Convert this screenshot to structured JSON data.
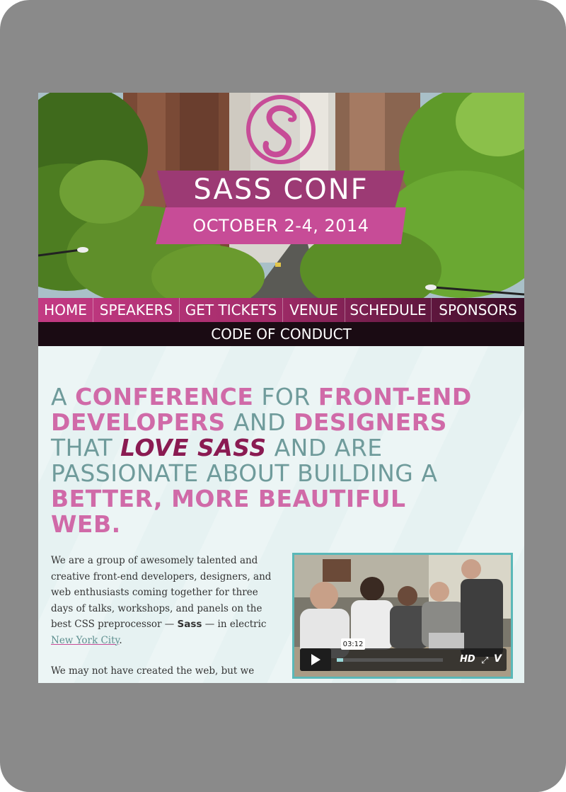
{
  "site": {
    "title": "SASS CONF",
    "dates": "OCTOBER 2-4, 2014"
  },
  "nav": {
    "items": [
      {
        "label": "HOME"
      },
      {
        "label": "SPEAKERS"
      },
      {
        "label": "GET TICKETS"
      },
      {
        "label": "VENUE"
      },
      {
        "label": "SCHEDULE"
      },
      {
        "label": "SPONSORS"
      }
    ],
    "code_of_conduct": "CODE OF CONDUCT"
  },
  "tagline": {
    "p1": "A ",
    "h1": "CONFERENCE",
    "p2": " FOR ",
    "h2": "FRONT-END DEVELOPERS",
    "p3": " AND ",
    "h3": "DESIGNERS",
    "p4": " THAT ",
    "h4": "LOVE SASS",
    "p5": " AND ARE PASSIONATE ABOUT BUILDING A ",
    "h5": "BETTER, MORE BEAUTIFUL WEB."
  },
  "intro": {
    "t1": "We are a group of awesomely talented and creative front-end developers, designers, and web enthusiasts coming together for three days of talks, workshops, and panels on the best CSS preprocessor — ",
    "bold": "Sass",
    "t2": " — in electric ",
    "link": "New York City",
    "t3": ".",
    "second": "We may not have created the web, but we"
  },
  "video": {
    "time": "03:12",
    "hd": "HD",
    "vimeo": "V",
    "progress_fraction": 0.06
  },
  "colors": {
    "pink": "#c74c97",
    "plum": "#9c3a74",
    "teal_text": "#6f9b9b",
    "dark_magenta": "#8a1b52"
  }
}
